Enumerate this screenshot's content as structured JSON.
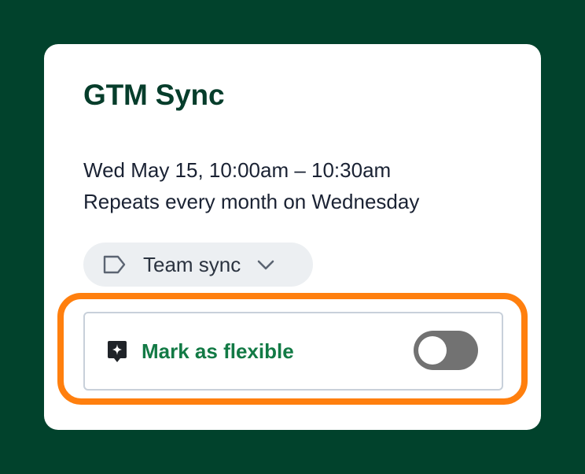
{
  "event": {
    "title": "GTM Sync",
    "when": "Wed May 15, 10:00am – 10:30am",
    "repeat": "Repeats every month on Wednesday"
  },
  "category": {
    "label": "Team sync",
    "icon": "tag-icon",
    "dropdown_icon": "chevron-down-icon"
  },
  "flexible": {
    "label": "Mark as flexible",
    "icon": "sparkle-icon",
    "enabled": false
  },
  "colors": {
    "background": "#01422c",
    "title": "#063d2b",
    "flexible_label": "#127a45",
    "highlight": "#ff7f0e",
    "toggle_off": "#727272"
  }
}
